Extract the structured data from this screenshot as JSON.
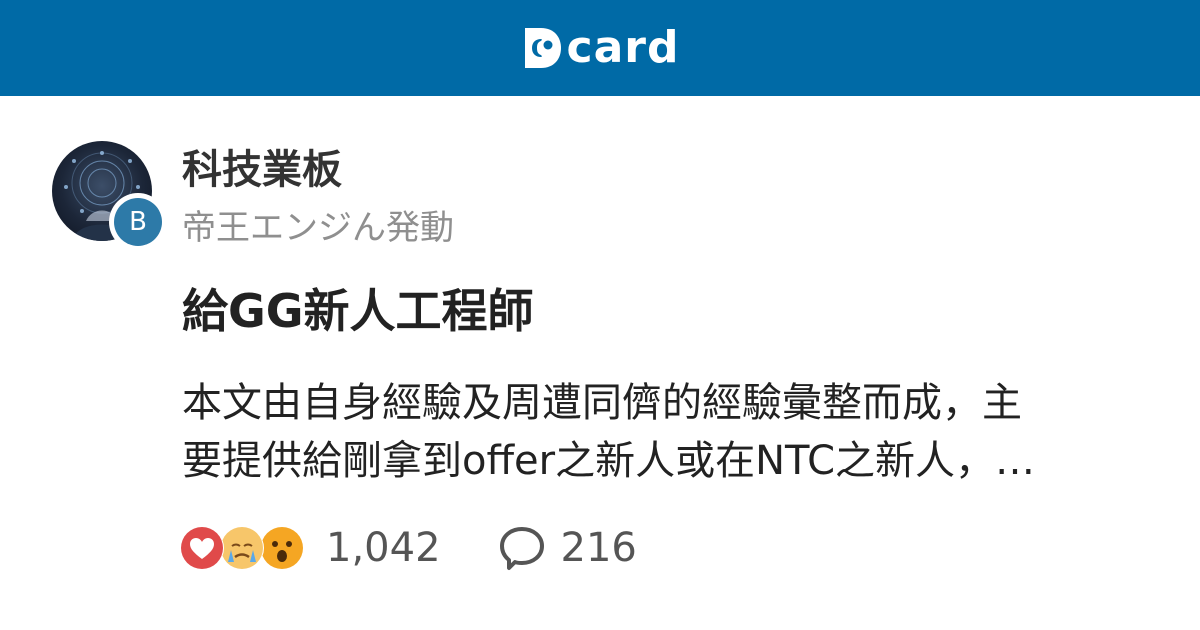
{
  "header": {
    "logo_text": "card",
    "logo_icon": "dcard-d-logo",
    "background": "#006aa6"
  },
  "board": {
    "name": "科技業板",
    "badge": "B",
    "badge_color": "#2d7aa8",
    "avatar_icon": "board-avatar-tech-image"
  },
  "post": {
    "author": "帝王エンジん発動",
    "title": "給GG新人工程師",
    "excerpt_lines": [
      "本文由自身經驗及周遭同儕的經驗彙整而成，主",
      "要提供給剛拿到offer之新人或在NTC之新人，…"
    ]
  },
  "stats": {
    "reactions": [
      "heart-icon",
      "crying-face-icon",
      "surprised-face-icon"
    ],
    "reaction_count": "1,042",
    "comment_icon": "comment-bubble-icon",
    "comment_count": "216"
  }
}
